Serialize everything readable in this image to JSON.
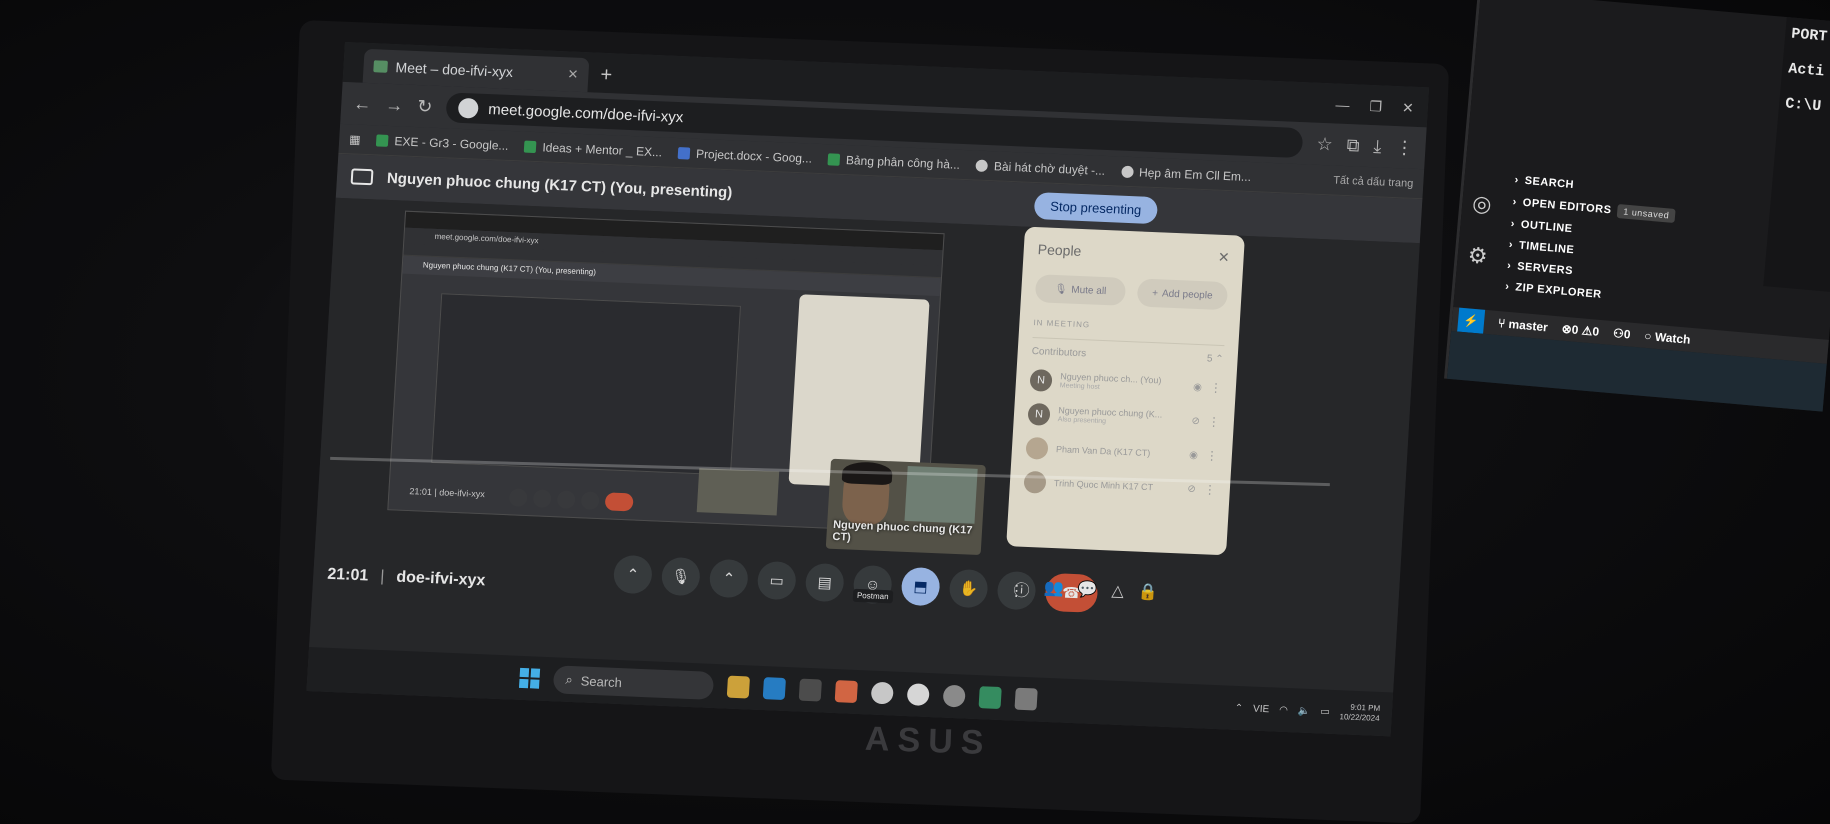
{
  "browser": {
    "tab_title": "Meet – doe-ifvi-xyx",
    "new_tab": "+",
    "url": "meet.google.com/doe-ifvi-xyx",
    "bookmarks": [
      {
        "label": "EXE - Gr3 - Google...",
        "icon": "sheets-icon"
      },
      {
        "label": "Ideas + Mentor _ EX...",
        "icon": "sheets-icon"
      },
      {
        "label": "Project.docx - Goog...",
        "icon": "docs-icon"
      },
      {
        "label": "Bảng phân công hà...",
        "icon": "sheets-icon"
      },
      {
        "label": "Bài hát chờ duyệt -...",
        "icon": "youtube-icon"
      },
      {
        "label": "Hẹp âm Em Cll Em...",
        "icon": "youtube-icon"
      }
    ],
    "all_bookmarks": "Tất cả dấu trang"
  },
  "meet": {
    "presenting_title": "Nguyen phuoc chung (K17 CT) (You, presenting)",
    "stop_presenting": "Stop presenting",
    "time": "21:01",
    "separator": "|",
    "meeting_code": "doe-ifvi-xyx",
    "self_video_name": "Nguyen phuoc chung (K17 CT)",
    "tooltip": "Postman",
    "people_panel": {
      "title": "People",
      "mute_all": "Mute all",
      "add_people": "Add people",
      "in_meeting": "IN MEETING",
      "contributors": "Contributors",
      "contributors_count": "5",
      "participants": [
        {
          "initial": "N",
          "name": "Nguyen phuoc ch... (You)",
          "sub": "Meeting host"
        },
        {
          "initial": "N",
          "name": "Nguyen phuoc chung (K...",
          "sub": "Also presenting"
        },
        {
          "initial": "",
          "name": "Pham Van Da (K17 CT)",
          "sub": ""
        },
        {
          "initial": "",
          "name": "Trinh Quoc Minh K17 CT",
          "sub": ""
        }
      ]
    }
  },
  "nested": {
    "url": "meet.google.com/doe-ifvi-xyx",
    "presenting": "Nguyen phuoc chung (K17 CT) (You, presenting)",
    "time": "21:01  |  doe-ifvi-xyx"
  },
  "taskbar": {
    "search_placeholder": "Search",
    "language": "VIE",
    "clock_time": "9:01 PM",
    "clock_date": "10/22/2024"
  },
  "vscode": {
    "terminal_lines": [
      "PORT",
      "Acti",
      "C:\\U"
    ],
    "explorer_sections": [
      "SEARCH",
      "OPEN EDITORS",
      "OUTLINE",
      "TIMELINE",
      "SERVERS",
      "ZIP EXPLORER"
    ],
    "unsaved_badge": "1 unsaved",
    "branch": "master",
    "errors": "0",
    "warnings": "0",
    "ports": "0",
    "watch": "Watch"
  },
  "hardware": {
    "brand": "ASUS"
  }
}
